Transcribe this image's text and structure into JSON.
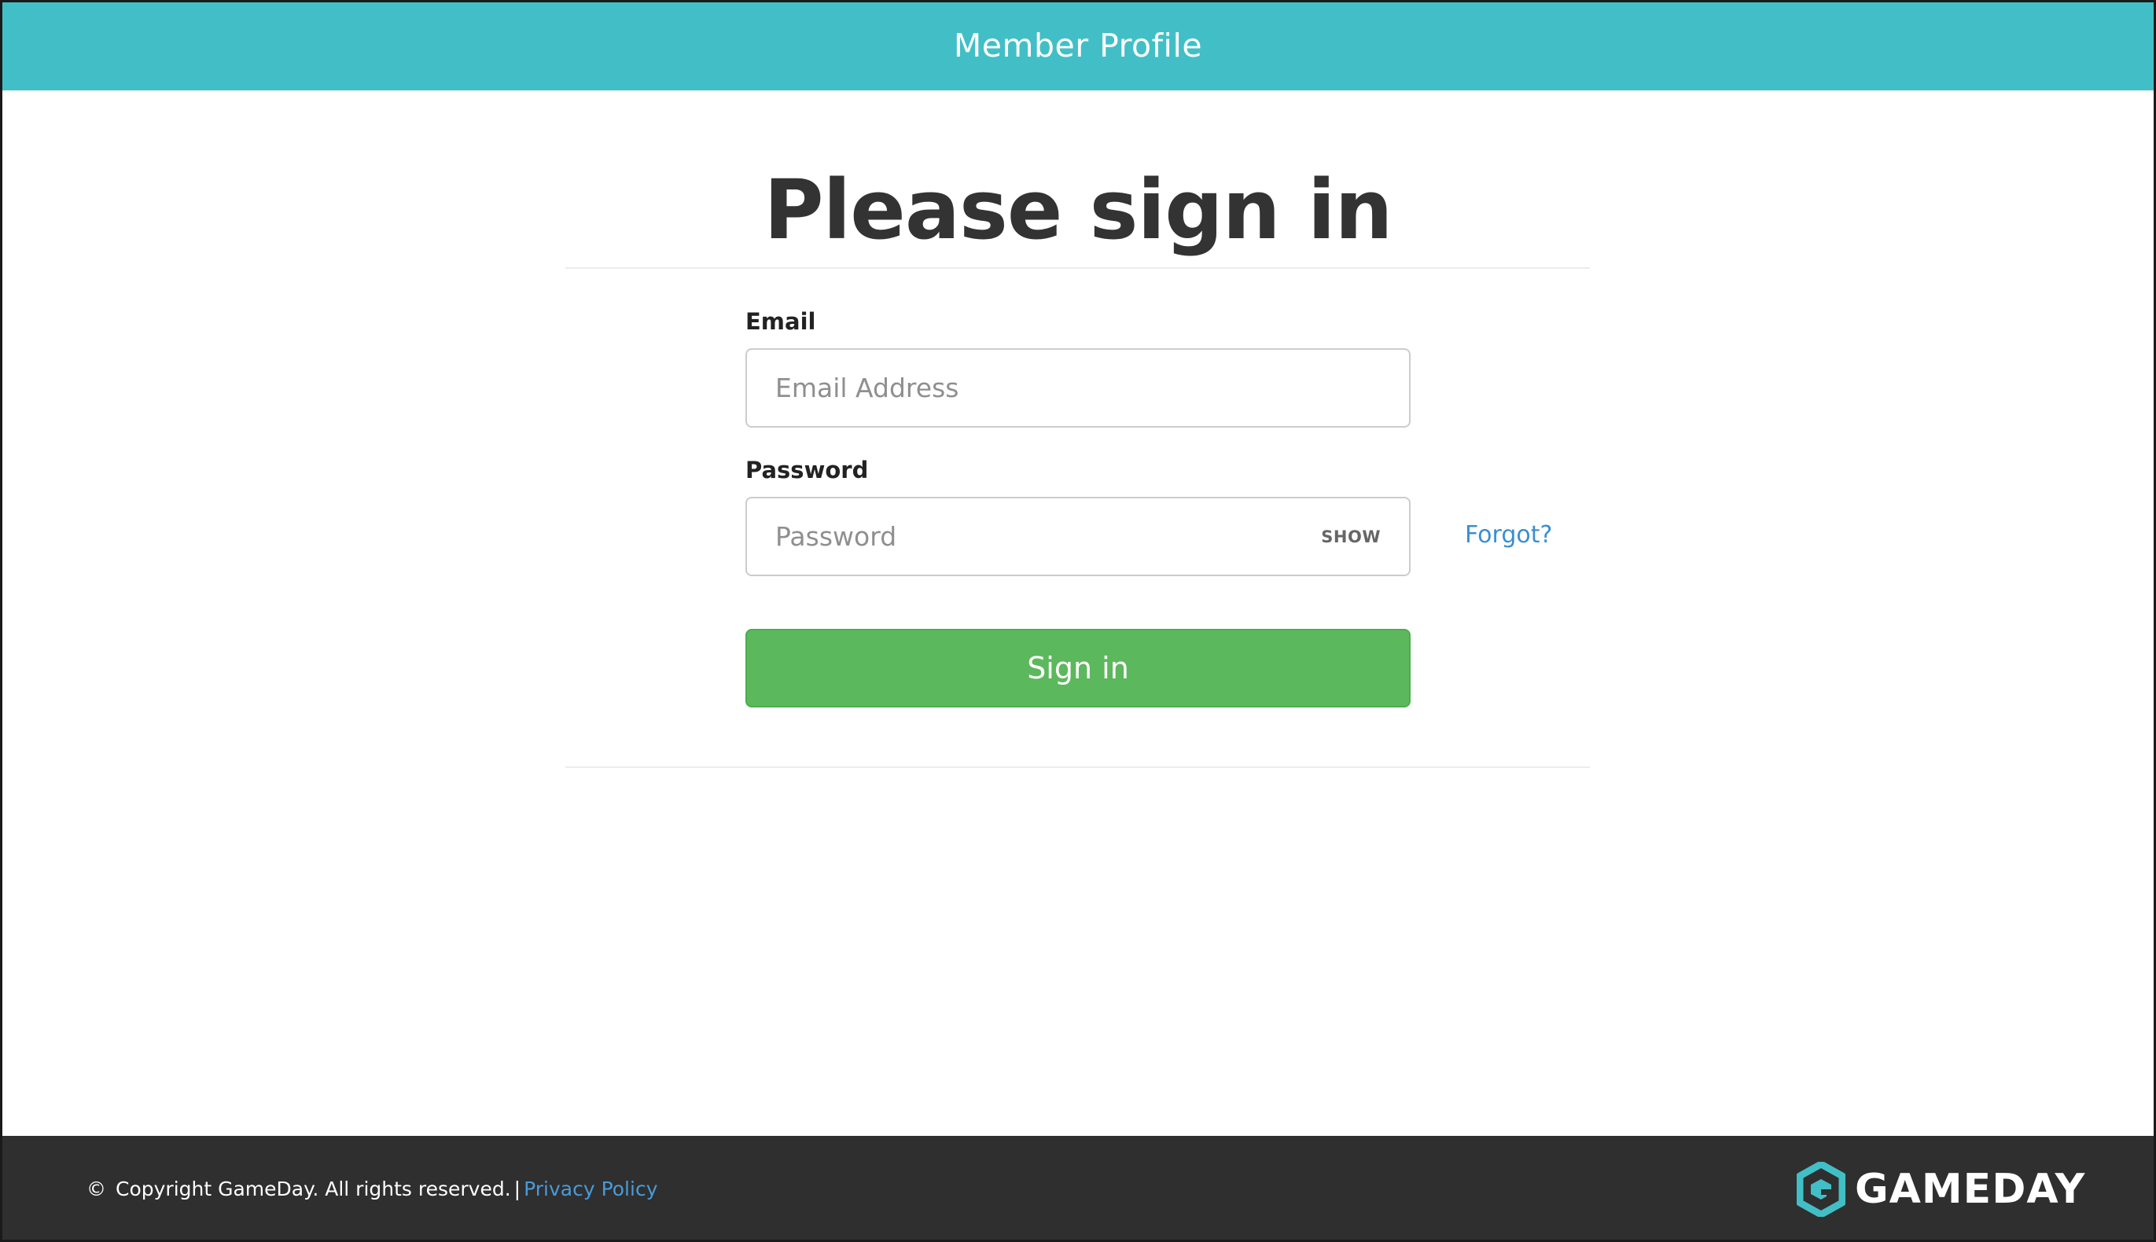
{
  "header": {
    "title": "Member Profile"
  },
  "main": {
    "heading": "Please sign in",
    "email": {
      "label": "Email",
      "value": "",
      "placeholder": "Email Address"
    },
    "password": {
      "label": "Password",
      "value": "",
      "placeholder": "Password",
      "show_label": "SHOW"
    },
    "forgot_label": "Forgot?",
    "signin_label": "Sign in"
  },
  "footer": {
    "copyright_symbol": "©",
    "copyright_text": "Copyright GameDay. All rights reserved.",
    "separator": "|",
    "privacy_label": "Privacy Policy",
    "logo_text": "GAMEDAY"
  },
  "colors": {
    "header_bg": "#42bfc6",
    "signin_button": "#5cb85c",
    "link": "#3a8fd0",
    "footer_bg": "#2f2f2f"
  },
  "icons": {
    "logo": "gameday-hexagon-logo-icon"
  }
}
